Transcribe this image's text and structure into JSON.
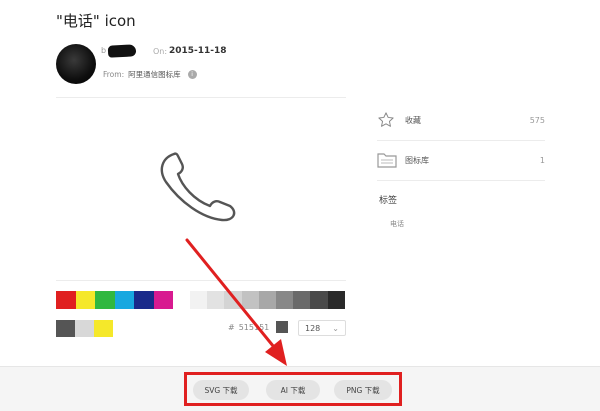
{
  "page": {
    "title": "\"电话\" icon"
  },
  "author": {
    "on_label": "On:",
    "date": "2015-11-18",
    "from_label": "From:",
    "library_name": "阿里通信图标库"
  },
  "sidebar": {
    "favorite_label": "收藏",
    "favorite_count": "575",
    "library_label": "图标库",
    "library_count": "1",
    "tags_title": "标签",
    "tag": "电话"
  },
  "colors": {
    "palette": [
      "#e02020",
      "#f5e82a",
      "#30b840",
      "#18a8e0",
      "#1a2a8a",
      "#d81a90"
    ],
    "grays": [
      "#f2f2f2",
      "#e2e2e2",
      "#d4d4d4",
      "#c2c2c2",
      "#a8a8a8",
      "#888888",
      "#6a6a6a",
      "#4a4a4a",
      "#2a2a2a"
    ],
    "recent": [
      "#555555",
      "#d8d8d8",
      "#f5e82a"
    ],
    "current_hex_prefix": "#",
    "current_hex": "515151",
    "current_swatch": "#555555",
    "annotation_red": "#e02020"
  },
  "size": {
    "value": "128",
    "chevron": "⌄"
  },
  "download": {
    "svg_label": "SVG 下载",
    "ai_label": "AI 下载",
    "png_label": "PNG 下载"
  }
}
